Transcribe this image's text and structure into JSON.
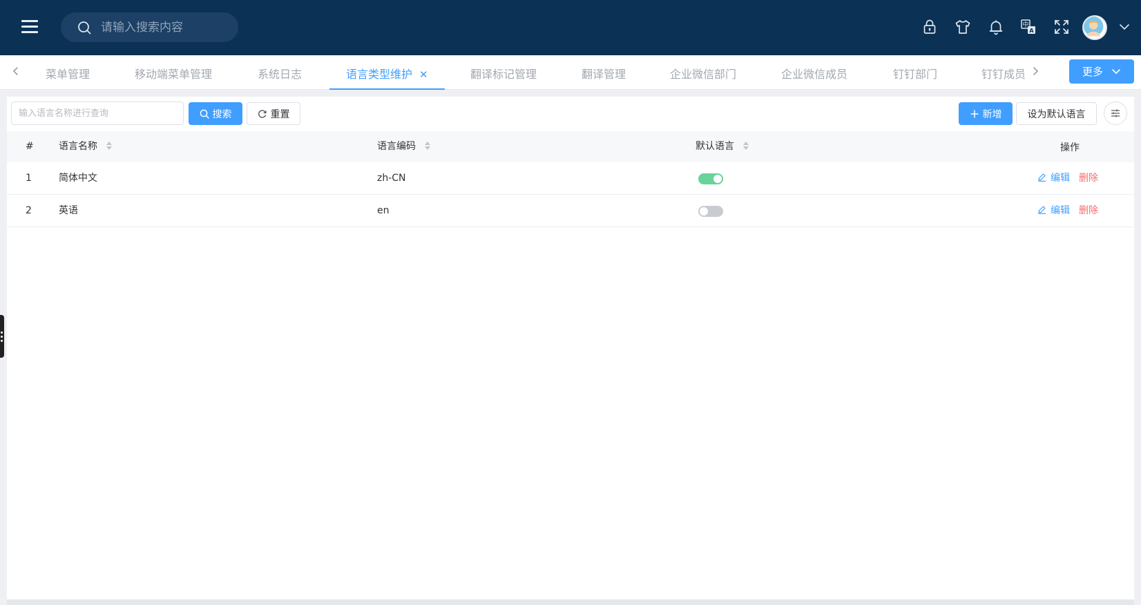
{
  "header": {
    "search_placeholder": "请输入搜索内容",
    "icons": [
      "lock-icon",
      "shirt-icon",
      "bell-icon",
      "translate-icon",
      "fullscreen-icon"
    ],
    "avatar": "avatar"
  },
  "tabs": {
    "items": [
      {
        "label": "菜单管理"
      },
      {
        "label": "移动端菜单管理"
      },
      {
        "label": "系统日志"
      },
      {
        "label": "语言类型维护",
        "active": true
      },
      {
        "label": "翻译标记管理"
      },
      {
        "label": "翻译管理"
      },
      {
        "label": "企业微信部门"
      },
      {
        "label": "企业微信成员"
      },
      {
        "label": "钉钉部门"
      },
      {
        "label": "钉钉成员"
      }
    ],
    "more_label": "更多"
  },
  "toolbar": {
    "query_placeholder": "输入语言名称进行查询",
    "search_label": "搜索",
    "reset_label": "重置",
    "add_label": "新增",
    "set_default_label": "设为默认语言"
  },
  "table": {
    "columns": [
      "#",
      "语言名称",
      "语言编码",
      "默认语言",
      "操作"
    ],
    "rows": [
      {
        "index": "1",
        "name": "简体中文",
        "code": "zh-CN",
        "is_default": true
      },
      {
        "index": "2",
        "name": "英语",
        "code": "en",
        "is_default": false
      }
    ],
    "edit_label": "编辑",
    "delete_label": "删除"
  },
  "colors": {
    "header_bg": "#0b3154",
    "primary": "#409eff",
    "danger": "#f56c6c",
    "switch_on": "#67d49a"
  }
}
